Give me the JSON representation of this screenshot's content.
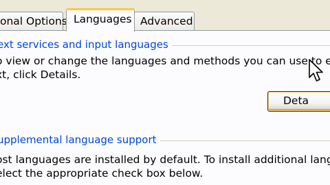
{
  "tabs": {
    "regional": "onal Options",
    "languages": "Languages",
    "advanced": "Advanced"
  },
  "text_services": {
    "title": "ext services and input languages",
    "line1": "o view or change the languages and methods you can use to enter",
    "line2": "xt, click Details.",
    "details_button": "Deta"
  },
  "supplemental": {
    "title": "upplemental language support",
    "line1": "ost languages are installed by default. To install additional languages",
    "line2": "elect the appropriate check box below."
  },
  "colors": {
    "group_title": "#0046d5",
    "tab_highlight": "#ffc83c",
    "dialog_background": "#ece9d8"
  },
  "icons": {
    "pointer": "arrow-cursor-icon"
  }
}
